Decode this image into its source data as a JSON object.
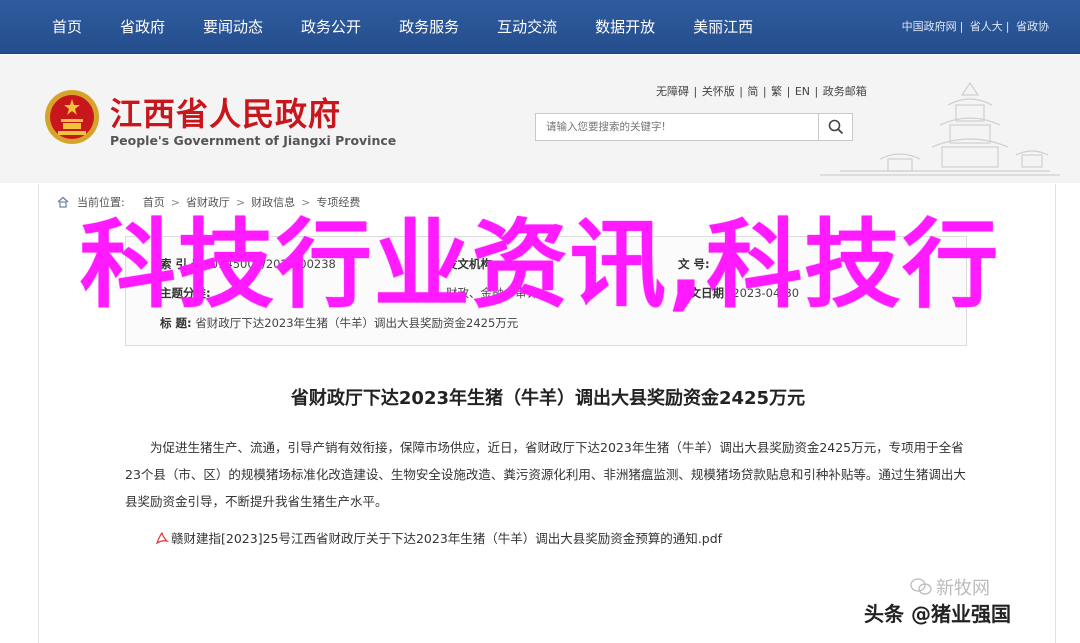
{
  "nav": {
    "items": [
      "首页",
      "省政府",
      "要闻动态",
      "政务公开",
      "政务服务",
      "互动交流",
      "数据开放",
      "美丽江西"
    ],
    "links": [
      "中国政府网",
      "省人大",
      "省政协"
    ]
  },
  "header": {
    "title": "江西省人民政府",
    "subtitle": "People's Government of Jiangxi Province",
    "util_links": [
      "无障碍",
      "关怀版",
      "简",
      "繁",
      "EN",
      "政务邮箱"
    ],
    "search_placeholder": "请输入您要搜索的关键字!"
  },
  "breadcrumb": {
    "label": "当前位置:",
    "items": [
      "首页",
      "省财政厅",
      "财政信息",
      "专项经费"
    ]
  },
  "meta": {
    "index_label": "索 引 号:",
    "index_value": "0145008/2023-00238",
    "org_label": "发文机构:",
    "doc_label": "文 号:",
    "category_label": "主题分类:",
    "category_value": "财政、金融、审计",
    "date_label": "成文日期:",
    "date_value": "2023-04-30",
    "subject_label": "标 题:",
    "subject_value": "省财政厅下达2023年生猪（牛羊）调出大县奖励资金2425万元"
  },
  "article": {
    "title": "省财政厅下达2023年生猪（牛羊）调出大县奖励资金2425万元",
    "body": "为促进生猪生产、流通，引导产销有效衔接，保障市场供应，近日，省财政厅下达2023年生猪（牛羊）调出大县奖励资金2425万元，专项用于全省23个县（市、区）的规模猪场标准化改造建设、生物安全设施改造、粪污资源化利用、非洲猪瘟监测、规模猪场贷款贴息和引种补贴等。通过生猪调出大县奖励资金引导，不断提升我省生猪生产水平。",
    "attachment": "赣财建指[2023]25号江西省财政厅关于下达2023年生猪（牛羊）调出大县奖励资金预算的通知.pdf"
  },
  "overlay": {
    "title": "科技行业资讯,科技行"
  },
  "watermark": {
    "top": "新牧网",
    "bottom": "头条 @猪业强国"
  },
  "colors": {
    "nav_bg": "#2f5c9f",
    "title_red": "#c8161d",
    "overlay_magenta": "#ff1aff"
  }
}
